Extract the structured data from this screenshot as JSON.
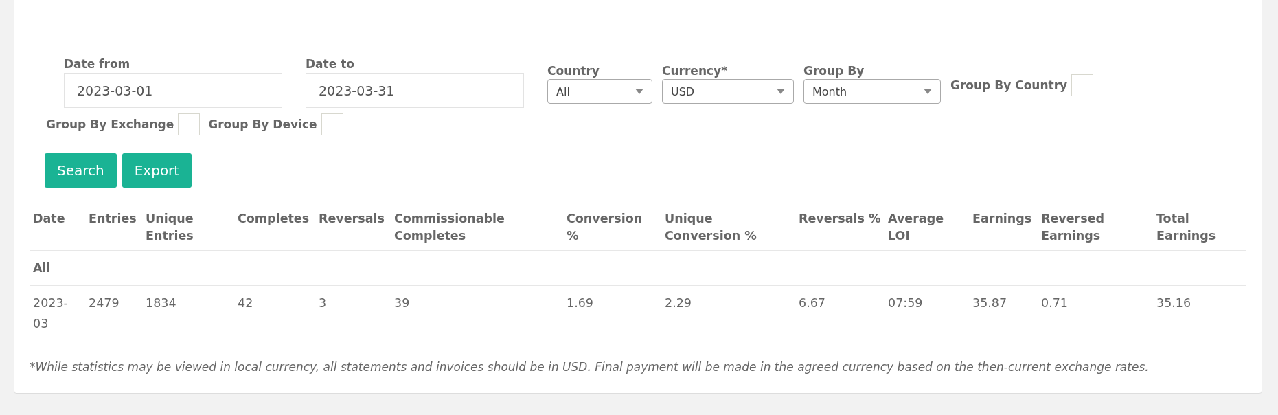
{
  "filters": {
    "date_from": {
      "label": "Date from",
      "value": "2023-03-01"
    },
    "date_to": {
      "label": "Date to",
      "value": "2023-03-31"
    },
    "selects": [
      {
        "label": "Country",
        "value": "All"
      },
      {
        "label": "Currency*",
        "value": "USD"
      },
      {
        "label": "Group By",
        "value": "Month"
      }
    ],
    "checkboxes": [
      {
        "label": "Group By Country",
        "checked": false
      },
      {
        "label": "Group By Exchange",
        "checked": false
      },
      {
        "label": "Group By Device",
        "checked": false
      }
    ],
    "buttons": [
      "Search",
      "Export"
    ]
  },
  "table": {
    "columns": [
      "Date",
      "Entries",
      "Unique Entries",
      "Completes",
      "Reversals",
      "Commissionable Completes",
      "Conversion %",
      "Unique Conversion %",
      "Reversals %",
      "Average LOI",
      "Earnings",
      "Reversed Earnings",
      "Total Earnings"
    ],
    "rows": [
      {
        "kind": "group",
        "cells": [
          "All"
        ]
      },
      {
        "kind": "data",
        "cells": [
          "2023-03",
          "2479",
          "1834",
          "42",
          "3",
          "39",
          "1.69",
          "2.29",
          "6.67",
          "07:59",
          "35.87",
          "0.71",
          "35.16"
        ]
      }
    ]
  },
  "footnote": "*While statistics may be viewed in local currency, all statements and invoices should be in USD. Final payment will be made in the agreed currency based on the then-current exchange rates."
}
